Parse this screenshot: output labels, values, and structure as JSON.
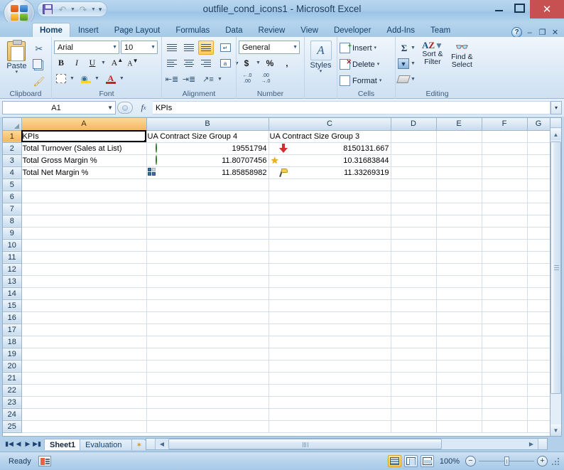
{
  "window": {
    "title": "outfile_cond_icons1 - Microsoft Excel",
    "minimize_label": "",
    "maximize_label": "",
    "close_label": "✕"
  },
  "quick_access": {
    "save_label": "Save",
    "undo_label": "Undo",
    "redo_label": "Redo",
    "customize_label": "▾"
  },
  "ribbon": {
    "tabs": [
      {
        "label": "Home",
        "active": true
      },
      {
        "label": "Insert",
        "active": false
      },
      {
        "label": "Page Layout",
        "active": false
      },
      {
        "label": "Formulas",
        "active": false
      },
      {
        "label": "Data",
        "active": false
      },
      {
        "label": "Review",
        "active": false
      },
      {
        "label": "View",
        "active": false
      },
      {
        "label": "Developer",
        "active": false
      },
      {
        "label": "Add-Ins",
        "active": false
      },
      {
        "label": "Team",
        "active": false
      }
    ],
    "help_label": "?",
    "ribbon_minimize_label": "–",
    "ribbon_restore_label": "❐",
    "ribbon_close_label": "✕",
    "groups": {
      "clipboard": {
        "label": "Clipboard",
        "paste_label": "Paste",
        "paste_caret": "▾",
        "cut_label": "Cut",
        "copy_label": "Copy",
        "format_painter_label": "Format Painter",
        "dialog_launcher": "↘"
      },
      "font": {
        "label": "Font",
        "font_name": "Arial",
        "font_size": "10",
        "bold_label": "B",
        "italic_label": "I",
        "underline_label": "U",
        "grow_font_label": "A",
        "shrink_font_label": "A",
        "borders_label": "Borders",
        "fill_color_label": "Fill Color",
        "font_color_label": "A",
        "dialog_launcher": "↘"
      },
      "alignment": {
        "label": "Alignment",
        "align_top_label": "Top Align",
        "align_middle_label": "Middle Align",
        "align_bottom_label": "Bottom Align",
        "align_left_label": "Align Text Left",
        "align_center_label": "Center",
        "align_right_label": "Align Text Right",
        "decrease_indent_label": "Decrease Indent",
        "increase_indent_label": "Increase Indent",
        "orientation_label": "Orientation",
        "wrap_text_label": "Wrap Text",
        "merge_label": "a",
        "dialog_launcher": "↘"
      },
      "number": {
        "label": "Number",
        "number_format": "General",
        "currency_label": "$",
        "percent_label": "%",
        "comma_label": ",",
        "increase_decimal_label": ".00",
        "decrease_decimal_label": ".00",
        "dialog_launcher": "↘"
      },
      "styles": {
        "label": "Styles",
        "caret": "▾"
      },
      "cells": {
        "label": "Cells",
        "insert_label": "Insert",
        "delete_label": "Delete",
        "format_label": "Format",
        "caret": "▾"
      },
      "editing": {
        "label": "Editing",
        "autosum_label": "Σ",
        "fill_label": "Fill",
        "clear_label": "Clear",
        "sort_filter_label_1": "Sort &",
        "sort_filter_label_2": "Filter",
        "find_select_label_1": "Find &",
        "find_select_label_2": "Select",
        "caret": "▾"
      }
    }
  },
  "formula_bar": {
    "name_box_value": "A1",
    "name_box_caret": "▾",
    "fx_label": "fx",
    "formula_value": "KPIs",
    "expand_caret": "▾"
  },
  "grid": {
    "selected_cell": "A1",
    "columns": [
      {
        "label": "A",
        "width": 176,
        "selected": true
      },
      {
        "label": "B",
        "width": 172,
        "selected": false
      },
      {
        "label": "C",
        "width": 172,
        "selected": false
      },
      {
        "label": "D",
        "width": 64,
        "selected": false
      },
      {
        "label": "E",
        "width": 64,
        "selected": false
      },
      {
        "label": "F",
        "width": 64,
        "selected": false
      },
      {
        "label": "G",
        "width": 32,
        "selected": false
      }
    ],
    "rows": [
      {
        "num": "1",
        "selected": true,
        "cells": [
          {
            "col": "A",
            "value": "KPIs",
            "align": "left",
            "icon": null,
            "selected": true
          },
          {
            "col": "B",
            "value": "UA Contract Size Group 4",
            "align": "left",
            "icon": null,
            "overflow": true
          },
          {
            "col": "C",
            "value": "UA Contract Size Group 3",
            "align": "left",
            "icon": null,
            "overflow": true
          },
          {
            "col": "D",
            "value": "",
            "align": "left",
            "icon": null
          },
          {
            "col": "E",
            "value": "",
            "align": "left",
            "icon": null
          },
          {
            "col": "F",
            "value": "",
            "align": "left",
            "icon": null
          },
          {
            "col": "G",
            "value": "",
            "align": "left",
            "icon": null
          }
        ]
      },
      {
        "num": "2",
        "selected": false,
        "cells": [
          {
            "col": "A",
            "value": "Total Turnover (Sales at List)",
            "align": "left",
            "icon": null
          },
          {
            "col": "B",
            "value": "19551794",
            "align": "right",
            "icon": "green-circle-icon"
          },
          {
            "col": "C",
            "value": "8150131.667",
            "align": "right",
            "icon": "red-down-arrow-icon"
          },
          {
            "col": "D",
            "value": "",
            "align": "left",
            "icon": null
          },
          {
            "col": "E",
            "value": "",
            "align": "left",
            "icon": null
          },
          {
            "col": "F",
            "value": "",
            "align": "left",
            "icon": null
          },
          {
            "col": "G",
            "value": "",
            "align": "left",
            "icon": null
          }
        ]
      },
      {
        "num": "3",
        "selected": false,
        "cells": [
          {
            "col": "A",
            "value": "Total Gross Margin %",
            "align": "left",
            "icon": null
          },
          {
            "col": "B",
            "value": "11.80707456",
            "align": "right",
            "icon": "green-check-circle-icon"
          },
          {
            "col": "C",
            "value": "10.31683844",
            "align": "right",
            "icon": "yellow-star-icon"
          },
          {
            "col": "D",
            "value": "",
            "align": "left",
            "icon": null
          },
          {
            "col": "E",
            "value": "",
            "align": "left",
            "icon": null
          },
          {
            "col": "F",
            "value": "",
            "align": "left",
            "icon": null
          },
          {
            "col": "G",
            "value": "",
            "align": "left",
            "icon": null
          }
        ]
      },
      {
        "num": "4",
        "selected": false,
        "cells": [
          {
            "col": "A",
            "value": "Total Net Margin %",
            "align": "left",
            "icon": null
          },
          {
            "col": "B",
            "value": "11.85858982",
            "align": "right",
            "icon": "quadrant-rating-icon"
          },
          {
            "col": "C",
            "value": "11.33269319",
            "align": "right",
            "icon": "yellow-flag-icon"
          },
          {
            "col": "D",
            "value": "",
            "align": "left",
            "icon": null
          },
          {
            "col": "E",
            "value": "",
            "align": "left",
            "icon": null
          },
          {
            "col": "F",
            "value": "",
            "align": "left",
            "icon": null
          },
          {
            "col": "G",
            "value": "",
            "align": "left",
            "icon": null
          }
        ]
      },
      {
        "num": "5",
        "selected": false,
        "cells": []
      },
      {
        "num": "6",
        "selected": false,
        "cells": []
      },
      {
        "num": "7",
        "selected": false,
        "cells": []
      },
      {
        "num": "8",
        "selected": false,
        "cells": []
      },
      {
        "num": "9",
        "selected": false,
        "cells": []
      },
      {
        "num": "10",
        "selected": false,
        "cells": []
      },
      {
        "num": "11",
        "selected": false,
        "cells": []
      },
      {
        "num": "12",
        "selected": false,
        "cells": []
      },
      {
        "num": "13",
        "selected": false,
        "cells": []
      },
      {
        "num": "14",
        "selected": false,
        "cells": []
      },
      {
        "num": "15",
        "selected": false,
        "cells": []
      },
      {
        "num": "16",
        "selected": false,
        "cells": []
      },
      {
        "num": "17",
        "selected": false,
        "cells": []
      },
      {
        "num": "18",
        "selected": false,
        "cells": []
      },
      {
        "num": "19",
        "selected": false,
        "cells": []
      },
      {
        "num": "20",
        "selected": false,
        "cells": []
      },
      {
        "num": "21",
        "selected": false,
        "cells": []
      },
      {
        "num": "22",
        "selected": false,
        "cells": []
      },
      {
        "num": "23",
        "selected": false,
        "cells": []
      },
      {
        "num": "24",
        "selected": false,
        "cells": []
      },
      {
        "num": "25",
        "selected": false,
        "cells": []
      }
    ]
  },
  "sheet_tabs": {
    "first_label": "⏮",
    "prev_label": "◀",
    "next_label": "▶",
    "last_label": "⏭",
    "tabs": [
      {
        "label": "Sheet1",
        "active": true
      },
      {
        "label": "Evaluation Warning",
        "active": false
      }
    ],
    "new_sheet_label": "✶"
  },
  "status_bar": {
    "status_text": "Ready",
    "normal_view_label": "Normal",
    "page_layout_label": "Page Layout",
    "page_break_label": "Page Break Preview",
    "zoom_level": "100%",
    "zoom_out_label": "−",
    "zoom_in_label": "+"
  },
  "colors": {
    "accent": "#a7c9e7",
    "selection": "#f3b85c",
    "close_button": "#c75050",
    "icon_green": "#4eab3d",
    "icon_red": "#d32f2f",
    "icon_yellow": "#e8b21e",
    "icon_blue": "#3a6ea5"
  }
}
